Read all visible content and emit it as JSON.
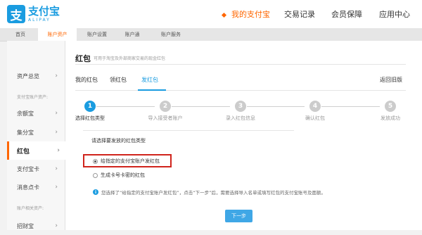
{
  "brand": {
    "name_cn": "支付宝",
    "name_en": "ALIPAY",
    "mark": "支"
  },
  "topnav": [
    {
      "label": "我的支付宝",
      "active": true
    },
    {
      "label": "交易记录"
    },
    {
      "label": "会员保障"
    },
    {
      "label": "应用中心"
    }
  ],
  "subnav": [
    {
      "label": "首页"
    },
    {
      "label": "账户资产",
      "active": true
    },
    {
      "label": "账户设置"
    },
    {
      "label": "账户通"
    },
    {
      "label": "账户服务"
    }
  ],
  "sidebar": {
    "items": [
      {
        "label": "资产总览"
      },
      {
        "label": "余额宝"
      },
      {
        "label": "集分宝"
      },
      {
        "label": "红包",
        "active": true
      },
      {
        "label": "支付宝卡"
      },
      {
        "label": "消息点卡"
      },
      {
        "label": "招财宝"
      }
    ],
    "cat1": "支付宝账户资产:",
    "cat2": "账户相关资产:"
  },
  "main": {
    "title": "红包",
    "subtitle": "可用于淘宝及外部商家交易的现金红包",
    "tabs": [
      {
        "label": "我的红包"
      },
      {
        "label": "领红包"
      },
      {
        "label": "发红包",
        "active": true
      }
    ],
    "back_link": "返回旧版",
    "steps": [
      {
        "num": "1",
        "label": "选择红包类型",
        "active": true
      },
      {
        "num": "2",
        "label": "导入接受者账户"
      },
      {
        "num": "3",
        "label": "录入红包信息"
      },
      {
        "num": "4",
        "label": "确认红包"
      },
      {
        "num": "5",
        "label": "发放成功"
      }
    ],
    "question": "请选择要发放的红包类型",
    "options": [
      {
        "label": "给指定的支付宝账户发红包",
        "checked": true
      },
      {
        "label": "生成卡号卡密的红包",
        "checked": false
      }
    ],
    "hint": "您选择了“给指定的支付宝账户发红包”，点击“下一步”后，需要选择导入名单或填写红包的支付宝账号及面额。",
    "next_button": "下一步"
  },
  "colors": {
    "accent": "#1a9ce0",
    "active_nav": "#ff6600",
    "highlight_box": "#d0241c"
  }
}
